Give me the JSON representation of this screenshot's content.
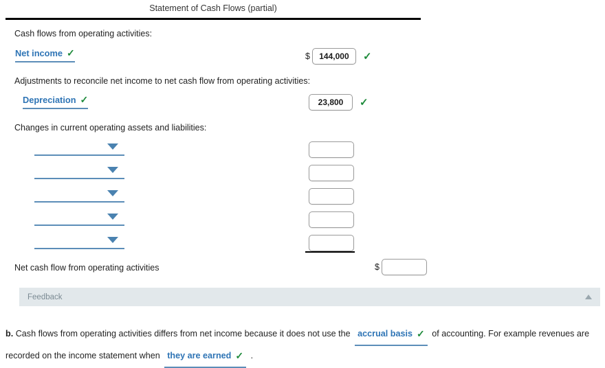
{
  "statement": {
    "title": "Statement of Cash Flows (partial)",
    "sections": {
      "operating_header": "Cash flows from operating activities:",
      "adjustments_header": "Adjustments to reconcile net income to net cash flow from operating activities:",
      "changes_header": "Changes in current operating assets and liabilities:",
      "total_label": "Net cash flow from operating activities"
    },
    "rows": {
      "net_income": {
        "label": "Net income",
        "label_check": "✓",
        "currency": "$",
        "value": "144,000",
        "value_check": "✓"
      },
      "depreciation": {
        "label": "Depreciation",
        "label_check": "✓",
        "value": "23,800",
        "value_check": "✓"
      },
      "blank_rows": [
        {
          "select_value": "",
          "amount_value": ""
        },
        {
          "select_value": "",
          "amount_value": ""
        },
        {
          "select_value": "",
          "amount_value": ""
        },
        {
          "select_value": "",
          "amount_value": ""
        },
        {
          "select_value": "",
          "amount_value": ""
        }
      ],
      "total": {
        "currency": "$",
        "value": ""
      }
    }
  },
  "feedback": {
    "label": "Feedback",
    "toggle_icon": "collapse-triangle-icon"
  },
  "question_b": {
    "marker": "b.",
    "text_1": "Cash flows from operating activities differs from net income because it does not use the",
    "answer_1": "accrual basis",
    "answer_1_check": "✓",
    "text_2": "of accounting. For example revenues are recorded on the income statement when",
    "answer_2": "they are earned",
    "answer_2_check": "✓",
    "text_3": "."
  },
  "colors": {
    "link_blue": "#2e74b5",
    "underline_blue": "#5b8db8",
    "check_green": "#1d8a3a",
    "feedback_bg": "#e2e8eb",
    "rule_black": "#000000"
  }
}
